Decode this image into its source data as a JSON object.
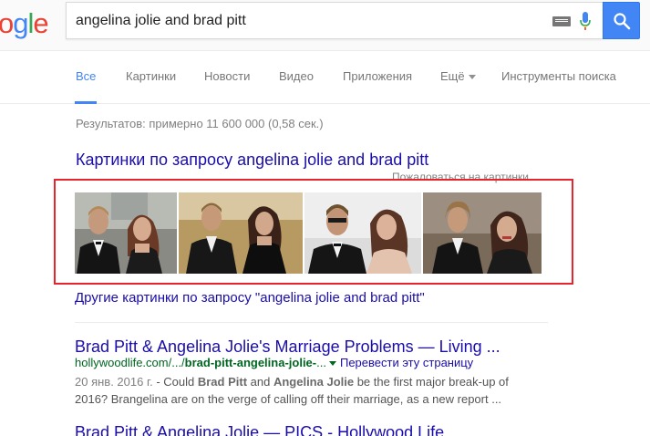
{
  "logo": {
    "letters": [
      "o",
      "g",
      "l",
      "e"
    ],
    "colors": [
      "#ea4335",
      "#4285f4",
      "#34a853",
      "#ea4335"
    ]
  },
  "search": {
    "query": "angelina jolie and brad pitt"
  },
  "tabs": [
    {
      "label": "Все",
      "active": true
    },
    {
      "label": "Картинки"
    },
    {
      "label": "Новости"
    },
    {
      "label": "Видео"
    },
    {
      "label": "Приложения"
    },
    {
      "label": "Ещё"
    },
    {
      "label": "Инструменты поиска"
    }
  ],
  "results_stats": "Результатов: примерно 11 600 000 (0,58 сек.)",
  "image_pack": {
    "title": "Картинки по запросу angelina jolie and brad pitt",
    "report": "Пожаловаться на картинки",
    "more": "Другие картинки по запросу \"angelina jolie and brad pitt\"",
    "thumbnail_count": 4
  },
  "results": [
    {
      "title": "Brad Pitt & Angelina Jolie's Marriage Problems — Living ...",
      "url_prefix": "hollywoodlife.com/.../",
      "url_bold": "brad-pitt-angelina-jolie-",
      "url_suffix": "...",
      "translate": "Перевести эту страницу",
      "date": "20 янв. 2016 г.",
      "snippet_1": " - Could ",
      "snippet_b1": "Brad Pitt",
      "snippet_2": " and ",
      "snippet_b2": "Angelina Jolie",
      "snippet_3": " be the first major break-up of 2016? Brangelina are on the verge of calling off their marriage, as a new report ..."
    },
    {
      "title": "Brad Pitt & Angelina Jolie — PICS - Hollywood Life"
    }
  ],
  "colors": {
    "accent": "#4285f4",
    "link": "#1a0dab",
    "url": "#006621",
    "highlight": "#e8242c"
  }
}
